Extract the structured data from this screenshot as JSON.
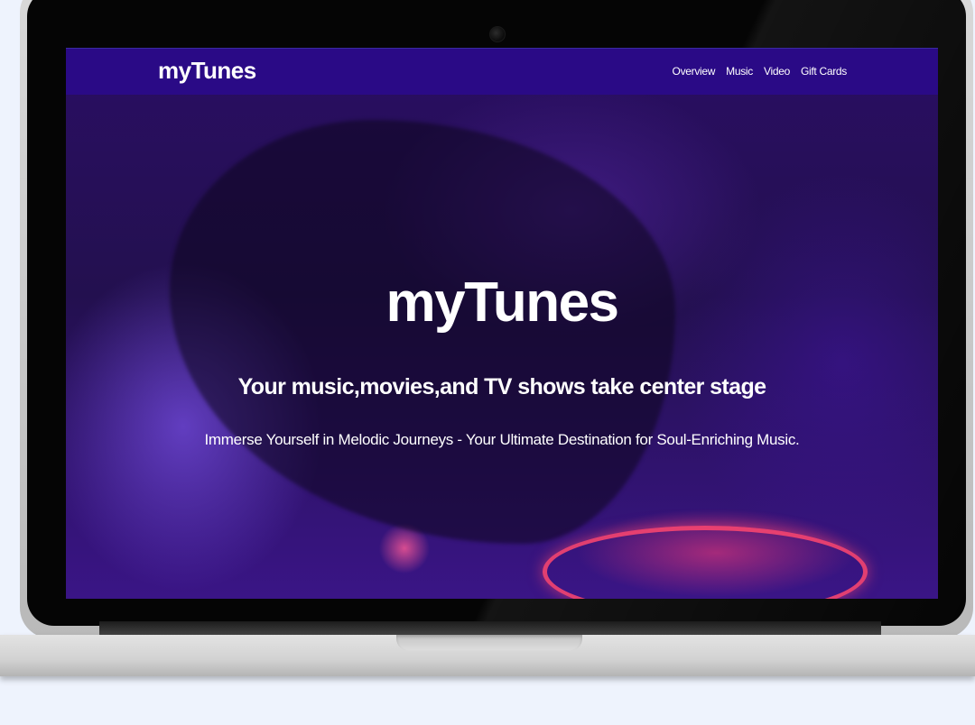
{
  "navbar": {
    "brand": "myTunes",
    "links": [
      "Overview",
      "Music",
      "Video",
      "Gift Cards"
    ]
  },
  "hero": {
    "title": "myTunes",
    "subtitle": "Your music,movies,and TV shows take center stage",
    "description": "Immerse Yourself in Melodic Journeys - Your Ultimate Destination for Soul-Enriching Music."
  },
  "colors": {
    "navbar_bg": "#2a0a86",
    "hero_tint": "#3a1586",
    "page_bg": "#eef3fd",
    "text": "#ffffff"
  }
}
